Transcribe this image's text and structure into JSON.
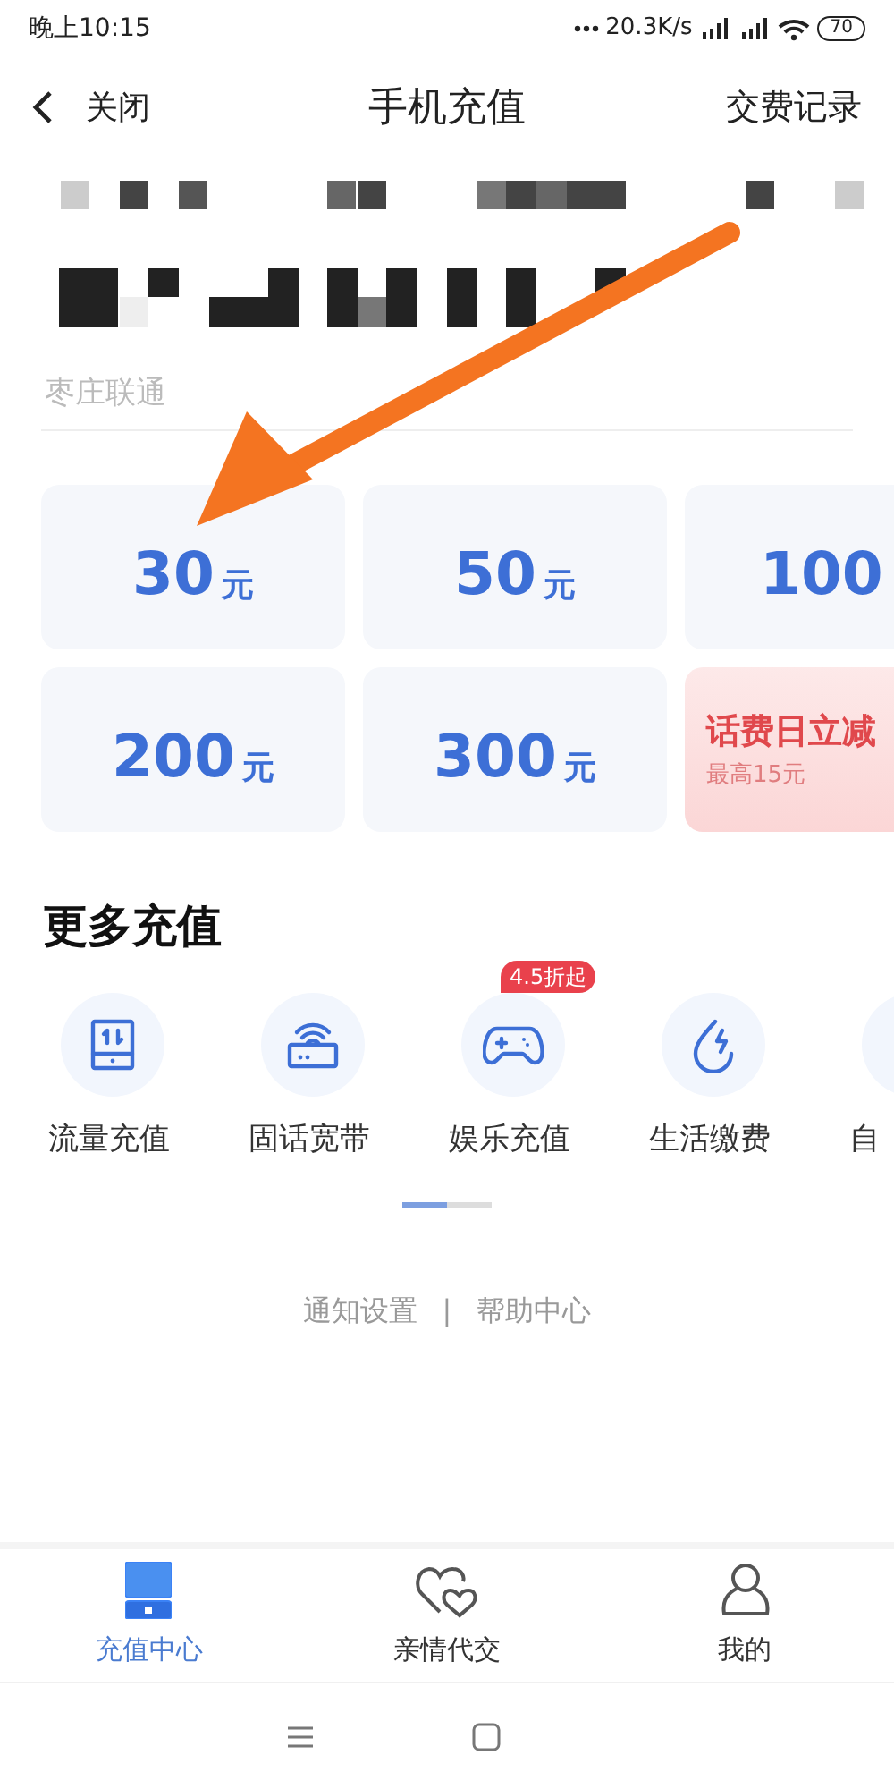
{
  "status_bar": {
    "time": "晚上10:15",
    "speed": "20.3K/s",
    "battery": "70"
  },
  "header": {
    "back_label": "关闭",
    "title": "手机充值",
    "action": "交费记录"
  },
  "account": {
    "carrier": "枣庄联通"
  },
  "amounts": [
    {
      "kind": "amount",
      "value": "30",
      "unit": "元"
    },
    {
      "kind": "amount",
      "value": "50",
      "unit": "元"
    },
    {
      "kind": "amount",
      "value": "100"
    },
    {
      "kind": "amount",
      "value": "200",
      "unit": "元"
    },
    {
      "kind": "amount",
      "value": "300",
      "unit": "元"
    },
    {
      "kind": "promo",
      "title": "话费日立减",
      "subtitle": "最高15元"
    }
  ],
  "more": {
    "title": "更多充值",
    "items": [
      {
        "kind": "data",
        "label": "流量充值"
      },
      {
        "kind": "broadband",
        "label": "固话宽带"
      },
      {
        "kind": "game",
        "label": "娱乐充值",
        "badge": "4.5折起"
      },
      {
        "kind": "utility",
        "label": "生活缴费"
      },
      {
        "kind": "auto",
        "label": "自"
      }
    ]
  },
  "links": [
    "通知设置",
    "帮助中心"
  ],
  "link_separator": "|",
  "tab_bar": [
    {
      "kind": "recharge",
      "label": "充值中心",
      "selected": true
    },
    {
      "kind": "family",
      "label": "亲情代交",
      "selected": false
    },
    {
      "kind": "me",
      "label": "我的",
      "selected": false
    }
  ]
}
